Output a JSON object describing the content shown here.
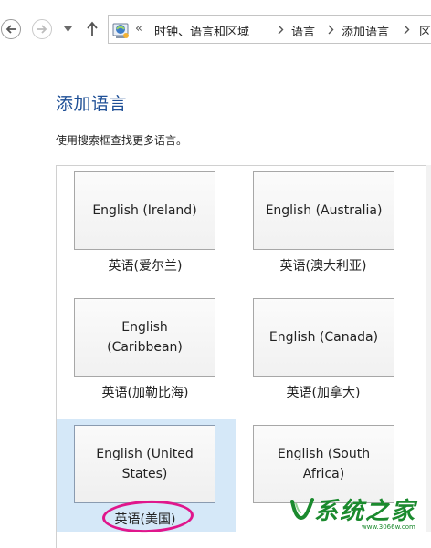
{
  "nav": {
    "breadcrumbs": [
      "时钟、语言和区域",
      "语言",
      "添加语言",
      "区"
    ],
    "overflow": "«"
  },
  "page": {
    "title": "添加语言",
    "subtitle": "使用搜索框查找更多语言。"
  },
  "languages": [
    {
      "tile": "English (Ireland)",
      "caption": "英语(爱尔兰)",
      "selected": false
    },
    {
      "tile": "English (Australia)",
      "caption": "英语(澳大利亚)",
      "selected": false
    },
    {
      "tile": "English (Caribbean)",
      "caption": "英语(加勒比海)",
      "selected": false
    },
    {
      "tile": "English (Canada)",
      "caption": "英语(加拿大)",
      "selected": false
    },
    {
      "tile": "English (United States)",
      "caption": "英语(美国)",
      "selected": true
    },
    {
      "tile": "English (South Africa)",
      "caption": "",
      "selected": false
    }
  ],
  "watermark": {
    "logo": "系统之家",
    "url": "www.3066w.com"
  },
  "colors": {
    "title": "#1e4f96",
    "selection": "#d5e8f8",
    "highlight": "#e0168c",
    "watermark": "#1b8a2e"
  }
}
